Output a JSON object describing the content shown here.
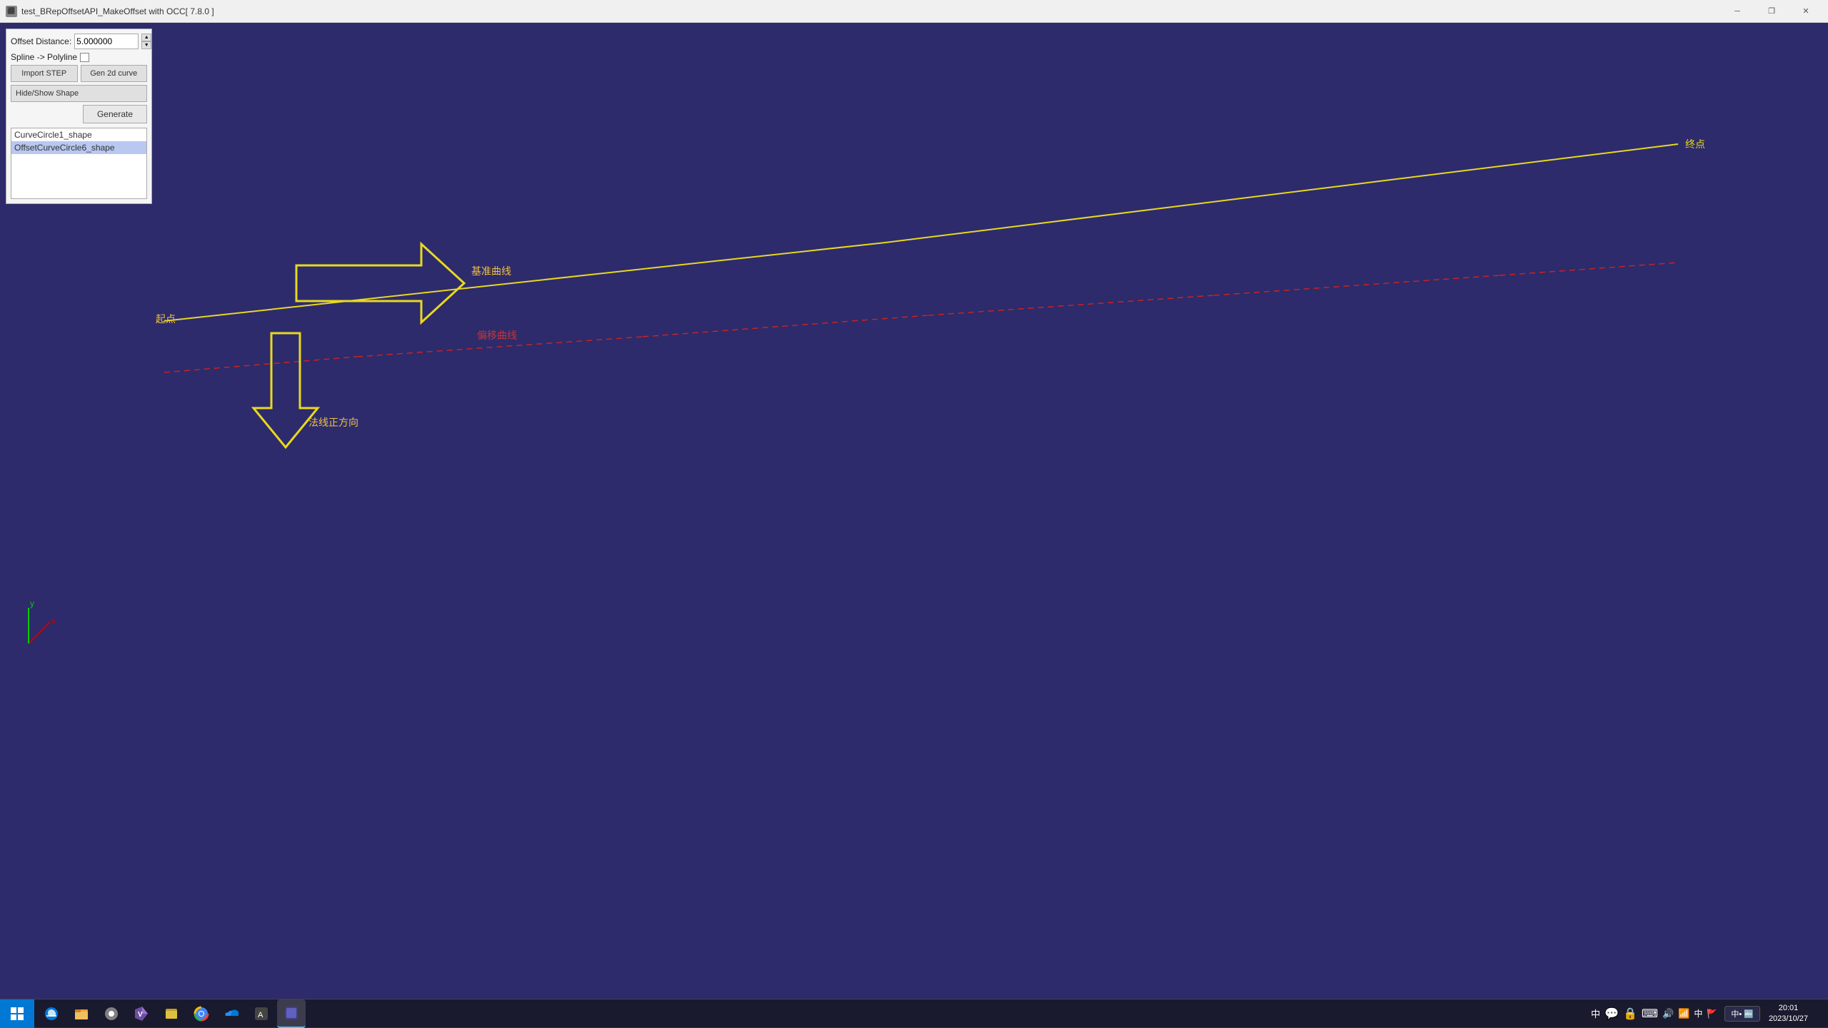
{
  "window": {
    "title": "test_BRepOffsetAPI_MakeOffset with OCC[ 7.8.0 ]",
    "icon": "⬛"
  },
  "controls": {
    "offset_distance_label": "Offset Distance:",
    "offset_distance_value": "5.000000",
    "spline_label": "Spline -> Polyline",
    "import_step_label": "Import STEP",
    "gen_2d_label": "Gen 2d curve",
    "hide_show_label": "Hide/Show Shape",
    "generate_label": "Generate",
    "shapes": [
      {
        "name": "CurveCircle1_shape",
        "selected": false
      },
      {
        "name": "OffsetCurveCircle6_shape",
        "selected": true
      }
    ]
  },
  "viewport": {
    "labels": {
      "start_point": "起点",
      "end_point": "终点",
      "baseline": "基准曲线",
      "offset_curve": "偏移曲线",
      "normal_direction": "法线正方向"
    }
  },
  "taskbar": {
    "time": "20:01",
    "date": "2023/10/27",
    "start_icon": "⊞",
    "apps": [
      "Edge",
      "File Explorer",
      "Settings",
      "Visual Studio",
      "Explorer",
      "Chrome",
      "OneDrive",
      "Unknown",
      "Unknown",
      "App"
    ]
  },
  "titlebar_controls": {
    "minimize": "─",
    "restore": "❐",
    "close": "✕"
  }
}
